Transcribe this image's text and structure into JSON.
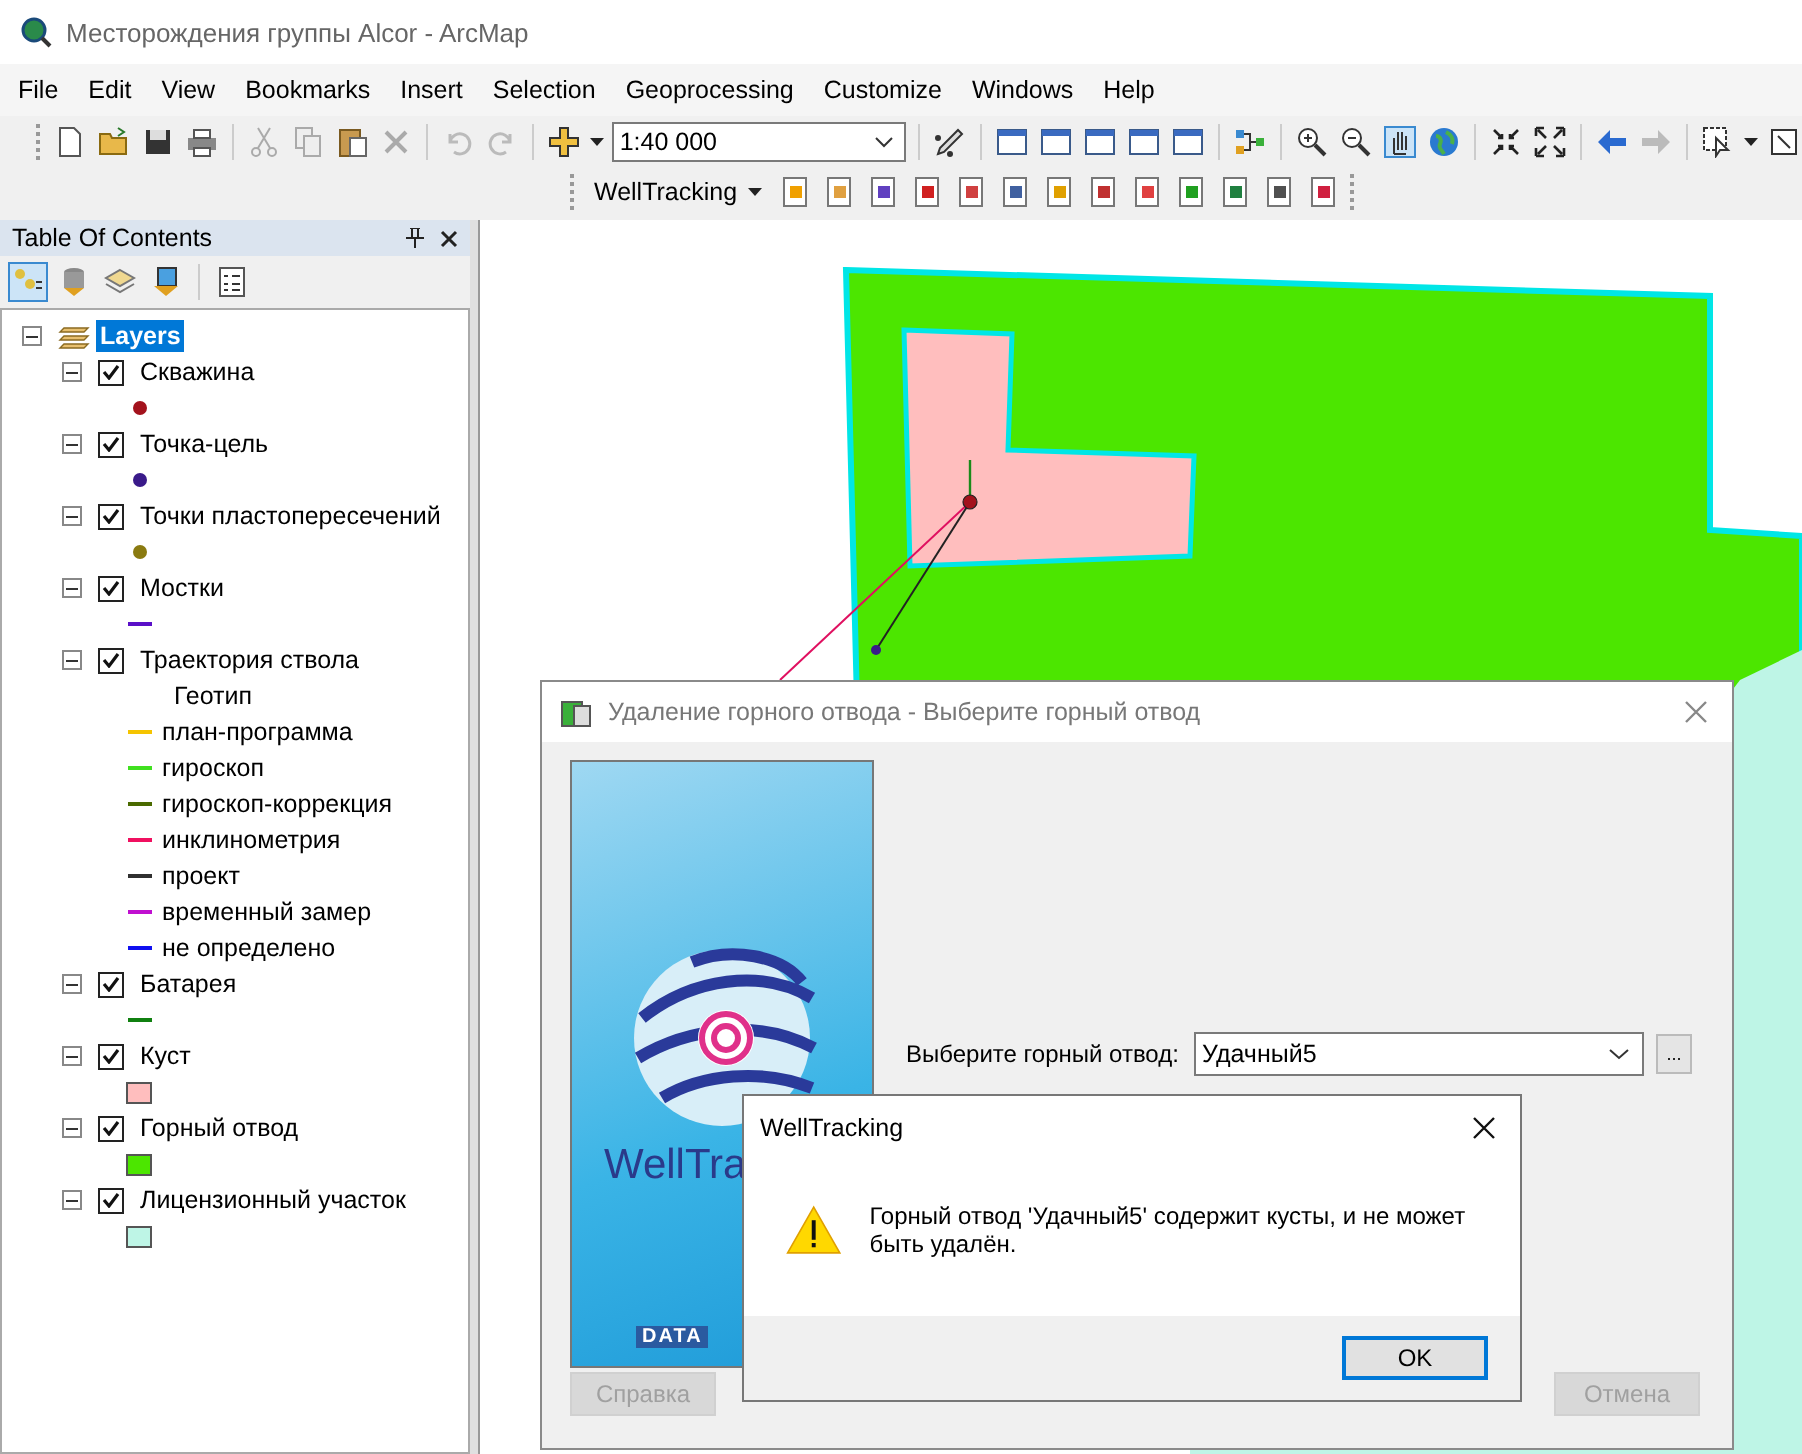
{
  "window": {
    "title": "Месторождения группы Alcor - ArcMap"
  },
  "menu": [
    "File",
    "Edit",
    "View",
    "Bookmarks",
    "Insert",
    "Selection",
    "Geoprocessing",
    "Customize",
    "Windows",
    "Help"
  ],
  "toolbar": {
    "scale": "1:40 000",
    "welltracking_menu": "WellTracking"
  },
  "toc": {
    "title": "Table Of Contents",
    "root": {
      "label": "Layers",
      "selected": true,
      "expanded": true,
      "layers": [
        {
          "name": "Скважина",
          "checked": true,
          "expanded": true,
          "legend": [
            {
              "kind": "point",
              "color": "#a3121c"
            }
          ]
        },
        {
          "name": "Точка-цель",
          "checked": true,
          "expanded": true,
          "legend": [
            {
              "kind": "point",
              "color": "#3a1a8a"
            }
          ]
        },
        {
          "name": "Точки пластопересечений",
          "checked": true,
          "expanded": true,
          "legend": [
            {
              "kind": "point",
              "color": "#8a7a10"
            }
          ]
        },
        {
          "name": "Мостки",
          "checked": true,
          "expanded": true,
          "legend": [
            {
              "kind": "line",
              "color": "#5a10c8"
            }
          ]
        },
        {
          "name": "Траектория ствола",
          "checked": true,
          "expanded": true,
          "legend": [
            {
              "kind": "heading",
              "label": "Геотип"
            },
            {
              "kind": "line",
              "color": "#f5c400",
              "label": "план-программа"
            },
            {
              "kind": "line",
              "color": "#40e020",
              "label": "гироскоп"
            },
            {
              "kind": "line",
              "color": "#4a6a00",
              "label": "гироскоп-коррекция"
            },
            {
              "kind": "line",
              "color": "#f01060",
              "label": "инклинометрия"
            },
            {
              "kind": "line",
              "color": "#303030",
              "label": "проект"
            },
            {
              "kind": "line",
              "color": "#c010d0",
              "label": "временный замер"
            },
            {
              "kind": "line",
              "color": "#1010f0",
              "label": "не определено"
            }
          ]
        },
        {
          "name": "Батарея",
          "checked": true,
          "expanded": true,
          "legend": [
            {
              "kind": "line",
              "color": "#108010"
            }
          ]
        },
        {
          "name": "Куст",
          "checked": true,
          "expanded": true,
          "legend": [
            {
              "kind": "fill",
              "color": "#ffbebe"
            }
          ]
        },
        {
          "name": "Горный отвод",
          "checked": true,
          "expanded": true,
          "legend": [
            {
              "kind": "fill",
              "color": "#4ce600"
            }
          ]
        },
        {
          "name": "Лицензионный участок",
          "checked": true,
          "expanded": true,
          "legend": [
            {
              "kind": "fill",
              "color": "#bef5e6"
            }
          ]
        }
      ]
    }
  },
  "dialog": {
    "title": "Удаление горного отвода - Выберите горный отвод",
    "banner_text": "WellTra",
    "banner_logo": "DATA",
    "field_label": "Выберите горный отвод:",
    "field_value": "Удачный5",
    "browse_button": "...",
    "buttons": [
      {
        "label": "Справка",
        "disabled": true
      },
      {
        "label": "Отмена",
        "disabled": true
      }
    ]
  },
  "message_box": {
    "title": "WellTracking",
    "message": "Горный отвод 'Удачный5' содержит кусты, и не может быть удалён.",
    "button": "OK"
  }
}
